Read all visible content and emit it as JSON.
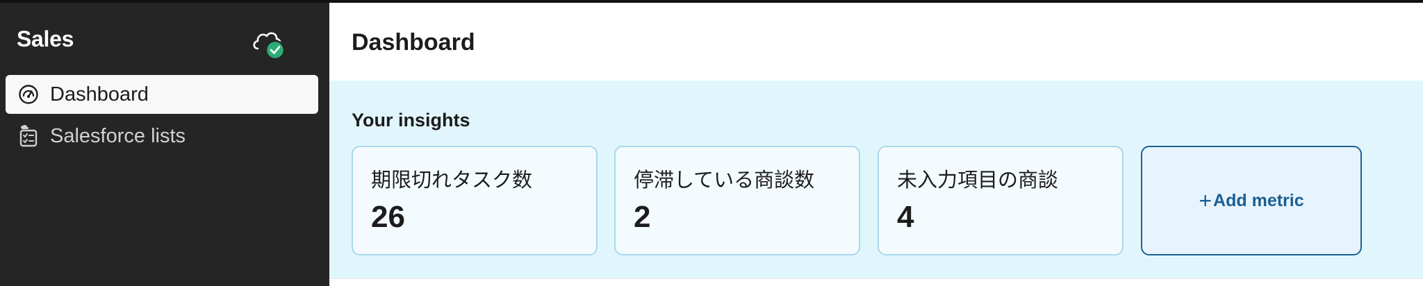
{
  "sidebar": {
    "title": "Sales",
    "items": [
      {
        "label": "Dashboard",
        "icon": "speedometer-icon",
        "active": true
      },
      {
        "label": "Salesforce lists",
        "icon": "list-checklist-icon",
        "active": false
      }
    ],
    "status_icon": "cloud-connected-icon"
  },
  "main": {
    "title": "Dashboard",
    "insights": {
      "title": "Your insights",
      "metrics": [
        {
          "label": "期限切れタスク数",
          "value": "26"
        },
        {
          "label": "停滞している商談数",
          "value": "2"
        },
        {
          "label": "未入力項目の商談",
          "value": "4"
        }
      ],
      "add_metric": {
        "plus": "+",
        "label": "Add metric"
      }
    }
  },
  "colors": {
    "sidebar_bg": "#252525",
    "insights_bg": "#e1f6fc",
    "card_border": "#a9d8eb",
    "accent": "#1a5f93",
    "status_green": "#2bac76"
  }
}
